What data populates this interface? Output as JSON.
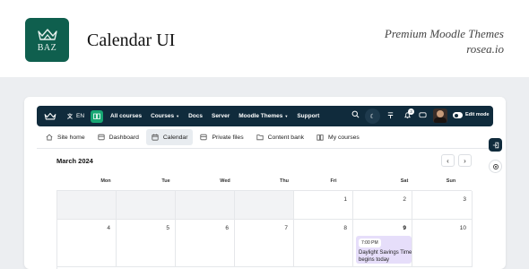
{
  "hero": {
    "logo_text": "BAZ",
    "title": "Calendar UI",
    "tagline": "Premium Moodle Themes",
    "site": "rosea.io"
  },
  "navbar": {
    "lang": "EN",
    "items": [
      "All courses",
      "Courses",
      "Docs",
      "Server",
      "Moodle Themes",
      "Support"
    ],
    "notification_count": "3",
    "edit_mode_label": "Edit mode"
  },
  "secondary_nav": {
    "items": [
      "Site home",
      "Dashboard",
      "Calendar",
      "Private files",
      "Content bank",
      "My courses"
    ],
    "active": "Calendar"
  },
  "calendar": {
    "month": "March 2024",
    "prev_label": "‹",
    "next_label": "›",
    "weekdays": [
      "Mon",
      "Tue",
      "Wed",
      "Thu",
      "Fri",
      "Sat",
      "Sun"
    ],
    "week1": [
      "",
      "",
      "",
      "",
      "1",
      "2",
      "3"
    ],
    "week2": [
      "4",
      "5",
      "6",
      "7",
      "8",
      "9",
      "10"
    ],
    "today": "9",
    "event": {
      "time": "7:00 PM",
      "title": "Daylight Savings Time begins today"
    }
  },
  "colors": {
    "brand": "#0f5f4e",
    "navbar": "#102b3c",
    "event_bg": "#e6defa",
    "background": "#eceef1"
  }
}
